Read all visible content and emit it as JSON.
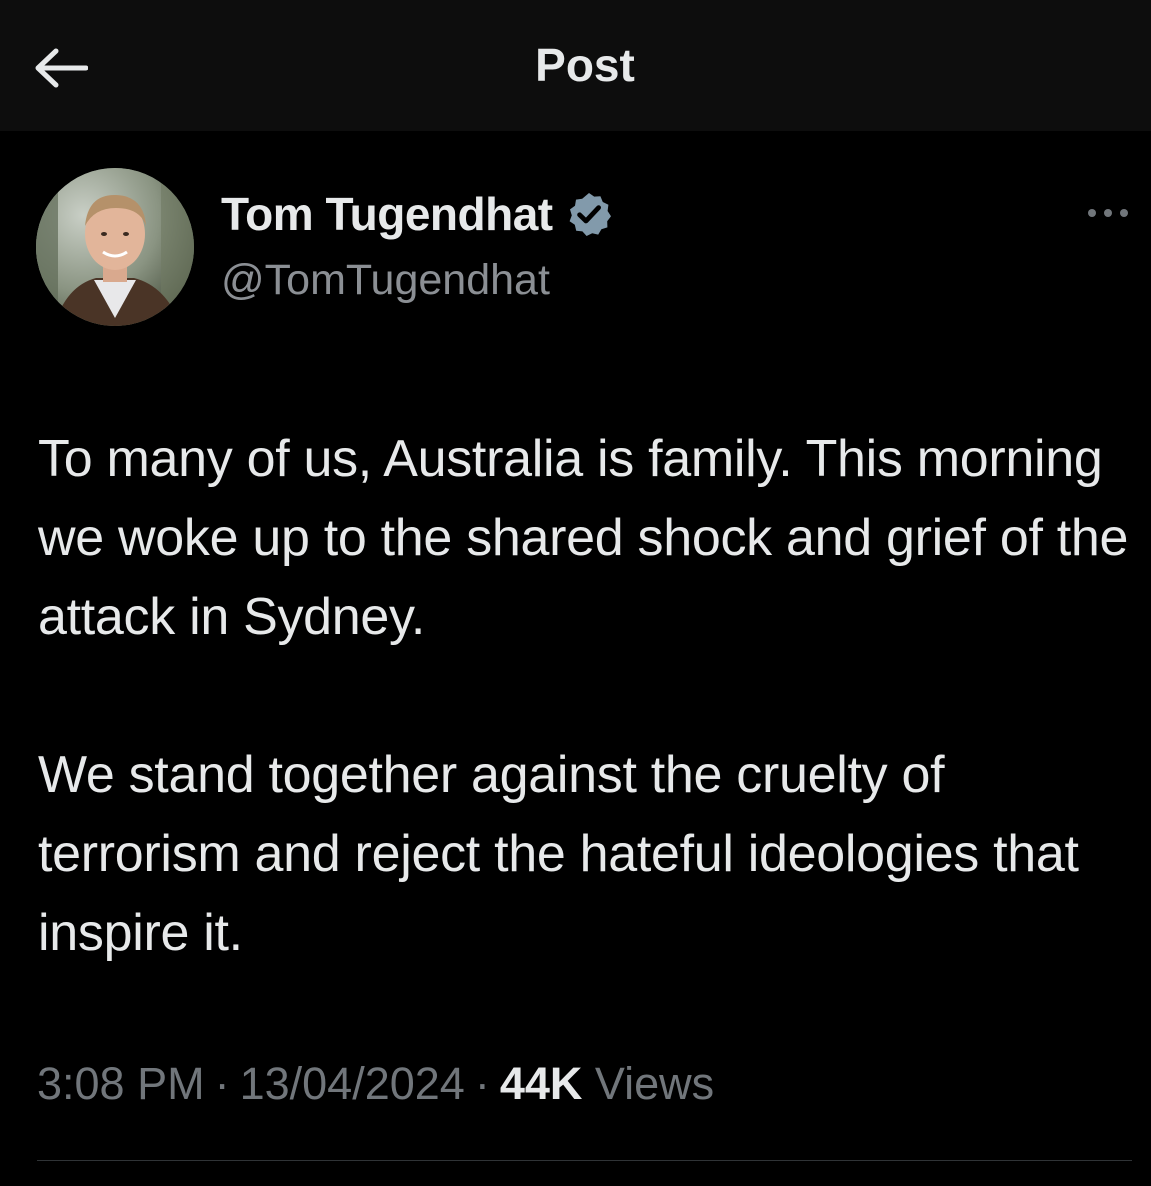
{
  "header": {
    "title": "Post",
    "back_icon": "arrow-left-icon"
  },
  "author": {
    "name": "Tom Tugendhat",
    "handle": "@TomTugendhat",
    "verified_icon": "verified-badge-icon",
    "verified_color": "#829aab"
  },
  "more_icon": "more-horizontal-icon",
  "post": {
    "paragraphs": [
      "To many of us, Australia is family. This morning we woke up to the shared shock and grief of the attack in Sydney.",
      "We stand together against the cruelty of terrorism and reject the hateful ideologies that inspire it."
    ]
  },
  "meta": {
    "time": "3:08 PM",
    "separator": "·",
    "date": "13/04/2024",
    "views_count": "44K",
    "views_label": "Views"
  },
  "colors": {
    "background": "#000000",
    "header_background": "#0d0d0d",
    "text": "#e7e9ea",
    "muted_text": "#71767b",
    "divider": "#2f3336"
  }
}
